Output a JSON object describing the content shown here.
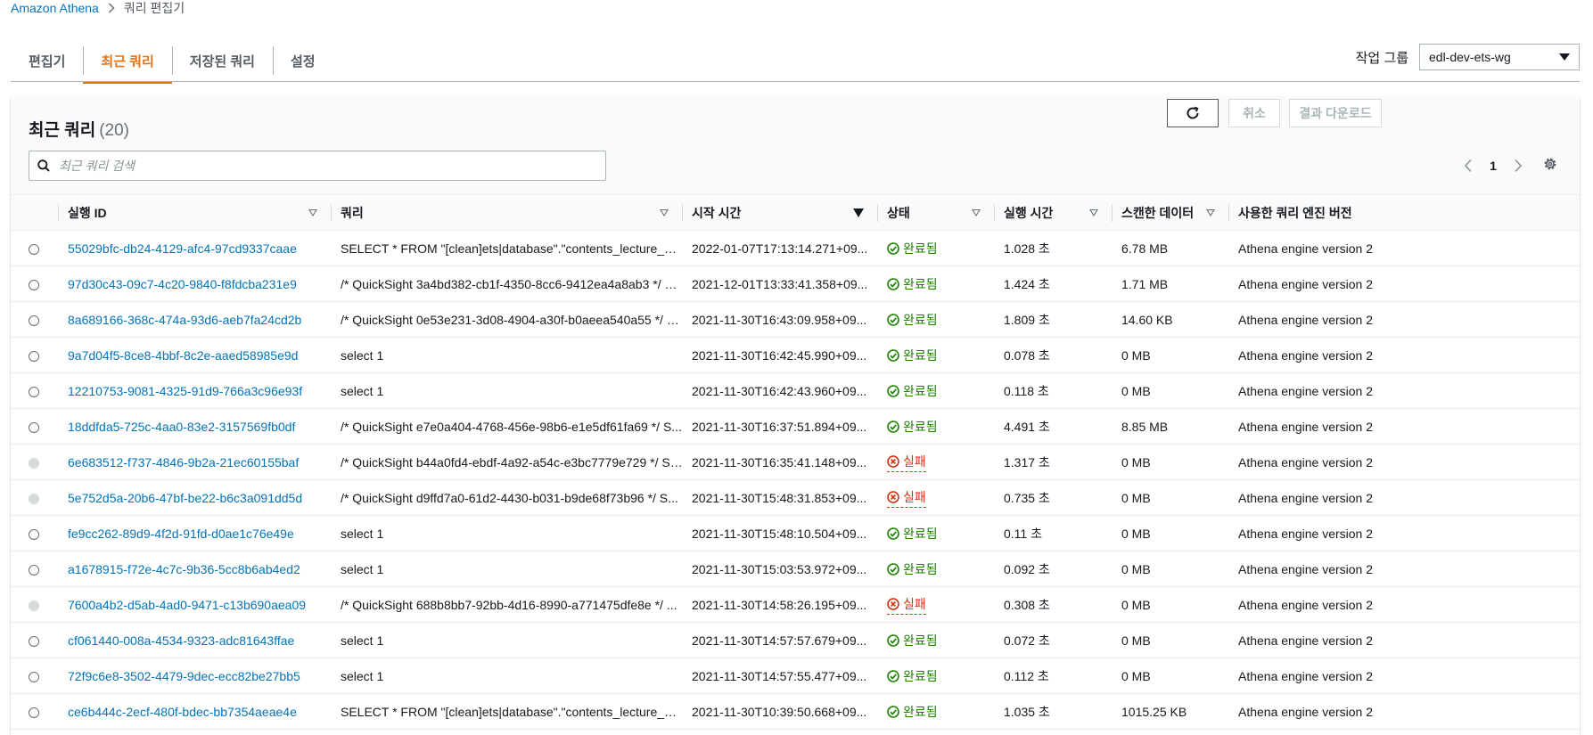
{
  "breadcrumb": {
    "root": "Amazon Athena",
    "current": "쿼리 편집기"
  },
  "tabs": [
    {
      "label": "편집기"
    },
    {
      "label": "최근 쿼리"
    },
    {
      "label": "저장된 쿼리"
    },
    {
      "label": "설정"
    }
  ],
  "active_tab": "최근 쿼리",
  "workgroup": {
    "label": "작업 그룹",
    "value": "edl-dev-ets-wg"
  },
  "panel": {
    "title": "최근 쿼리",
    "count": "(20)",
    "cancel_label": "취소",
    "download_label": "결과 다운로드",
    "search_placeholder": "최근 쿼리 검색",
    "page": "1"
  },
  "columns": {
    "id": "실행 ID",
    "query": "쿼리",
    "start": "시작 시간",
    "status": "상태",
    "runtime": "실행 시간",
    "scanned": "스캔한 데이터",
    "engine": "사용한 쿼리 엔진 버전"
  },
  "rows": [
    {
      "id": "55029bfc-db24-4129-afc4-97cd9337caae",
      "query": "SELECT * FROM \"[clean]ets|database\".\"contents_lecture_group...",
      "start": "2022-01-07T17:13:14.271+09...",
      "status": "완료됨",
      "state": "ok",
      "runtime": "1.028 초",
      "scanned": "6.78 MB",
      "engine": "Athena engine version 2"
    },
    {
      "id": "97d30c43-09c7-4c20-9840-f8fdcba231e9",
      "query": "/* QuickSight 3a4bd382-cb1f-4350-8cc6-9412ea4a8ab3 */ S...",
      "start": "2021-12-01T13:33:41.358+09...",
      "status": "완료됨",
      "state": "ok",
      "runtime": "1.424 초",
      "scanned": "1.71 MB",
      "engine": "Athena engine version 2"
    },
    {
      "id": "8a689166-368c-474a-93d6-aeb7fa24cd2b",
      "query": "/* QuickSight 0e53e231-3d08-4904-a30f-b0aeea540a55 */ S...",
      "start": "2021-11-30T16:43:09.958+09...",
      "status": "완료됨",
      "state": "ok",
      "runtime": "1.809 초",
      "scanned": "14.60 KB",
      "engine": "Athena engine version 2"
    },
    {
      "id": "9a7d04f5-8ce8-4bbf-8c2e-aaed58985e9d",
      "query": "select 1",
      "start": "2021-11-30T16:42:45.990+09...",
      "status": "완료됨",
      "state": "ok",
      "runtime": "0.078 초",
      "scanned": "0 MB",
      "engine": "Athena engine version 2"
    },
    {
      "id": "12210753-9081-4325-91d9-766a3c96e93f",
      "query": "select 1",
      "start": "2021-11-30T16:42:43.960+09...",
      "status": "완료됨",
      "state": "ok",
      "runtime": "0.118 초",
      "scanned": "0 MB",
      "engine": "Athena engine version 2"
    },
    {
      "id": "18ddfda5-725c-4aa0-83e2-3157569fb0df",
      "query": "/* QuickSight e7e0a404-4768-456e-98b6-e1e5df61fa69 */ S...",
      "start": "2021-11-30T16:37:51.894+09...",
      "status": "완료됨",
      "state": "ok",
      "runtime": "4.491 초",
      "scanned": "8.85 MB",
      "engine": "Athena engine version 2"
    },
    {
      "id": "6e683512-f737-4846-9b2a-21ec60155baf",
      "query": "/* QuickSight b44a0fd4-ebdf-4a92-a54c-e3bc7779e729 */ SE...",
      "start": "2021-11-30T16:35:41.148+09...",
      "status": "실패",
      "state": "fail",
      "runtime": "1.317 초",
      "scanned": "0 MB",
      "engine": "Athena engine version 2"
    },
    {
      "id": "5e752d5a-20b6-47bf-be22-b6c3a091dd5d",
      "query": "/* QuickSight d9ffd7a0-61d2-4430-b031-b9de68f73b96 */ S...",
      "start": "2021-11-30T15:48:31.853+09...",
      "status": "실패",
      "state": "fail",
      "runtime": "0.735 초",
      "scanned": "0 MB",
      "engine": "Athena engine version 2"
    },
    {
      "id": "fe9cc262-89d9-4f2d-91fd-d0ae1c76e49e",
      "query": "select 1",
      "start": "2021-11-30T15:48:10.504+09...",
      "status": "완료됨",
      "state": "ok",
      "runtime": "0.11 초",
      "scanned": "0 MB",
      "engine": "Athena engine version 2"
    },
    {
      "id": "a1678915-f72e-4c7c-9b36-5cc8b6ab4ed2",
      "query": "select 1",
      "start": "2021-11-30T15:03:53.972+09...",
      "status": "완료됨",
      "state": "ok",
      "runtime": "0.092 초",
      "scanned": "0 MB",
      "engine": "Athena engine version 2"
    },
    {
      "id": "7600a4b2-d5ab-4ad0-9471-c13b690aea09",
      "query": "/* QuickSight 688b8bb7-92bb-4d16-8990-a771475dfe8e */ ...",
      "start": "2021-11-30T14:58:26.195+09...",
      "status": "실패",
      "state": "fail",
      "runtime": "0.308 초",
      "scanned": "0 MB",
      "engine": "Athena engine version 2"
    },
    {
      "id": "cf061440-008a-4534-9323-adc81643ffae",
      "query": "select 1",
      "start": "2021-11-30T14:57:57.679+09...",
      "status": "완료됨",
      "state": "ok",
      "runtime": "0.072 초",
      "scanned": "0 MB",
      "engine": "Athena engine version 2"
    },
    {
      "id": "72f9c6e8-3502-4479-9dec-ecc82be27bb5",
      "query": "select 1",
      "start": "2021-11-30T14:57:55.477+09...",
      "status": "완료됨",
      "state": "ok",
      "runtime": "0.112 초",
      "scanned": "0 MB",
      "engine": "Athena engine version 2"
    },
    {
      "id": "ce6b444c-2ecf-480f-bdec-bb7354aeae4e",
      "query": "SELECT * FROM \"[clean]ets|database\".\"contents_lecture_group...",
      "start": "2021-11-30T10:39:50.668+09...",
      "status": "완료됨",
      "state": "ok",
      "runtime": "1.035 초",
      "scanned": "1015.25 KB",
      "engine": "Athena engine version 2"
    }
  ],
  "colors": {
    "accent": "#ec7211",
    "link": "#0073bb",
    "success": "#1d8102",
    "error": "#d13212"
  }
}
